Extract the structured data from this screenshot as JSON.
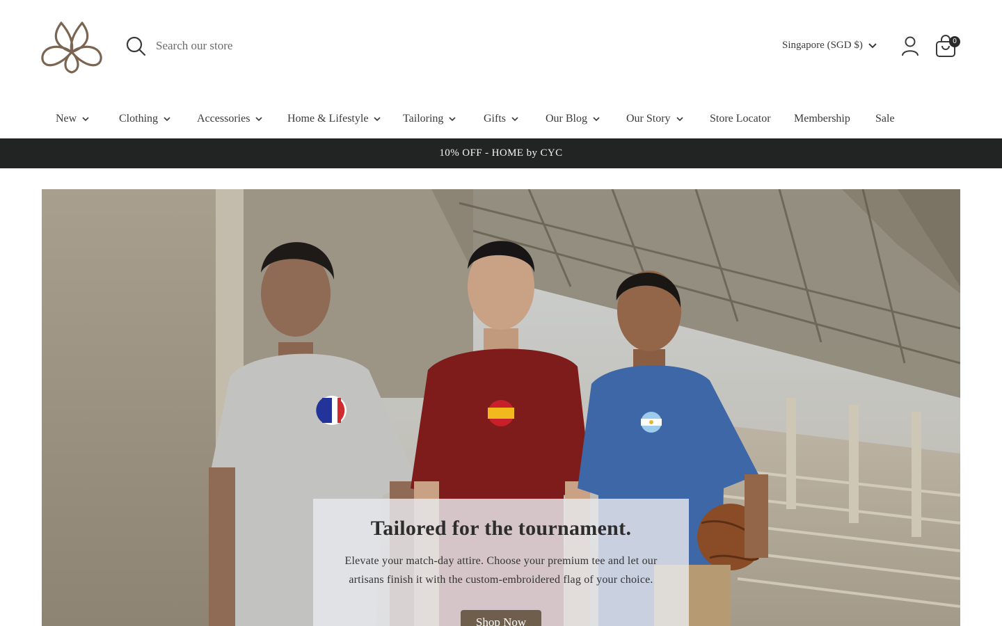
{
  "header": {
    "logo_name": "brand-knot-logo",
    "search_placeholder": "Search our store",
    "currency_label": "Singapore (SGD $)",
    "cart_count": "0"
  },
  "nav": {
    "items": [
      {
        "label": "New",
        "has_dropdown": true
      },
      {
        "label": "Clothing",
        "has_dropdown": true
      },
      {
        "label": "Accessories",
        "has_dropdown": true
      },
      {
        "label": "Home & Lifestyle",
        "has_dropdown": true
      },
      {
        "label": "Tailoring",
        "has_dropdown": true
      },
      {
        "label": "Gifts",
        "has_dropdown": true
      },
      {
        "label": "Our Blog",
        "has_dropdown": true
      },
      {
        "label": "Our Story",
        "has_dropdown": true
      },
      {
        "label": "Store Locator",
        "has_dropdown": false
      },
      {
        "label": "Membership",
        "has_dropdown": false
      },
      {
        "label": "Sale",
        "has_dropdown": false
      }
    ]
  },
  "promo": {
    "text": "10% OFF - HOME by CYC"
  },
  "hero": {
    "title": "Tailored for the tournament.",
    "text": "Elevate your match-day attire. Choose your premium tee and let our artisans finish it with the custom-embroidered flag of your choice.",
    "button_label": "Shop Now"
  },
  "colors": {
    "accent_brown": "#6f5e4c",
    "logo_brown": "#7a6552",
    "promo_bg": "#222323",
    "text": "#3a3a3a"
  }
}
